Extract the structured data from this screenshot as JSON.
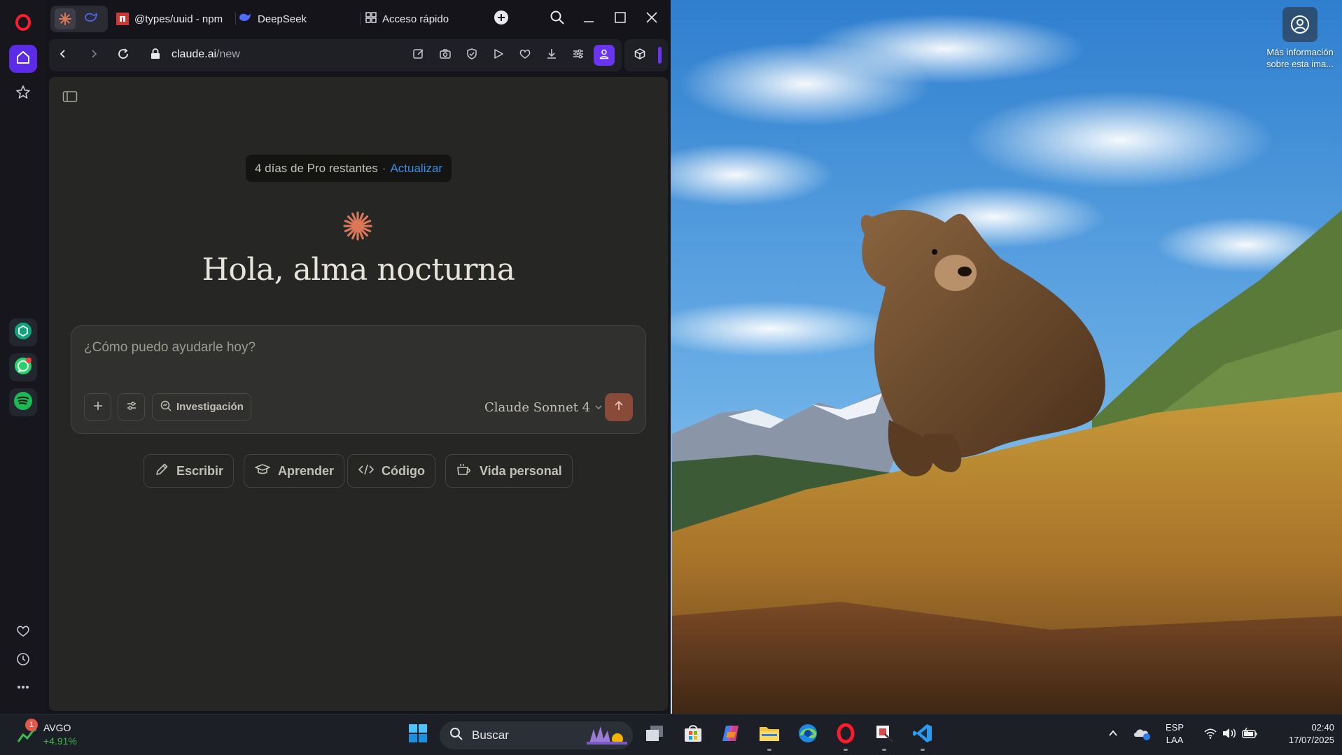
{
  "browser": {
    "tabs": [
      {
        "label": "@types/uuid - npm"
      },
      {
        "label": "DeepSeek"
      },
      {
        "label": "Acceso rápido"
      }
    ],
    "address": {
      "domain": "claude.ai",
      "path": "/new"
    }
  },
  "claude": {
    "pro_banner": {
      "text": "4 días de Pro restantes",
      "separator": "·",
      "link": "Actualizar"
    },
    "greeting": "Hola, alma nocturna",
    "prompt": {
      "placeholder": "¿Cómo puedo ayudarle hoy?",
      "value": ""
    },
    "research_button": "Investigación",
    "model": "Claude Sonnet 4",
    "quick_actions": [
      {
        "label": "Escribir",
        "icon": "pencil-icon"
      },
      {
        "label": "Aprender",
        "icon": "graduation-cap-icon"
      },
      {
        "label": "Código",
        "icon": "code-icon"
      },
      {
        "label": "Vida personal",
        "icon": "coffee-cup-icon"
      }
    ],
    "colors": {
      "accent": "#d97757",
      "send": "#8a4a3a",
      "link": "#3a8ee6"
    }
  },
  "desktop": {
    "spotlight": {
      "line1": "Más información",
      "line2": "sobre esta ima..."
    }
  },
  "taskbar": {
    "stock": {
      "symbol": "AVGO",
      "change": "+4.91%",
      "badge": "1"
    },
    "search_placeholder": "Buscar",
    "language": {
      "top": "ESP",
      "bottom": "LAA"
    },
    "clock": {
      "time": "02:40",
      "date": "17/07/2025"
    }
  }
}
